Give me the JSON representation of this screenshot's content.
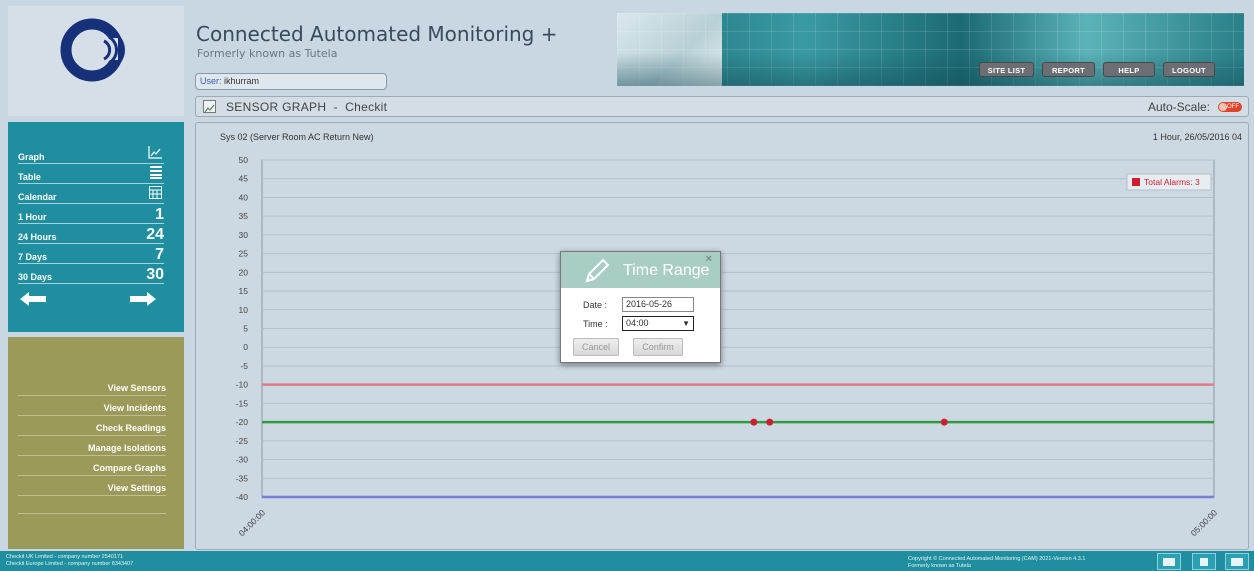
{
  "header": {
    "title": "Connected Automated Monitoring +",
    "subtitle": "Formerly known as Tutela",
    "user_label": "User:",
    "user_name": "ikhurram"
  },
  "top_nav": [
    {
      "label": "SITE LIST"
    },
    {
      "label": "REPORT"
    },
    {
      "label": "HELP"
    },
    {
      "label": "LOGOUT"
    }
  ],
  "graph_bar": {
    "title": "SENSOR GRAPH",
    "separator": "-",
    "subtitle": "Checkit",
    "autoscale_label": "Auto-Scale:",
    "autoscale_state": "OFF"
  },
  "sidebar": {
    "items": [
      {
        "label": "Graph",
        "icon": "chart-icon"
      },
      {
        "label": "Table",
        "icon": "table-icon"
      },
      {
        "label": "Calendar",
        "icon": "calendar-icon"
      },
      {
        "label": "1 Hour",
        "value": "1"
      },
      {
        "label": "24 Hours",
        "value": "24"
      },
      {
        "label": "7 Days",
        "value": "7"
      },
      {
        "label": "30 Days",
        "value": "30"
      }
    ],
    "prev_icon": "arrow-left-icon",
    "next_icon": "arrow-right-icon",
    "links": [
      {
        "label": "View Sensors"
      },
      {
        "label": "View Incidents"
      },
      {
        "label": "Check Readings"
      },
      {
        "label": "Manage Isolations"
      },
      {
        "label": "Compare Graphs"
      },
      {
        "label": "View Settings"
      }
    ]
  },
  "chart_data": {
    "type": "line",
    "title": "Sys 02 (Server Room AC Return New)",
    "range_label": "1 Hour, 26/05/2016 04",
    "y_ticks": [
      "50",
      "45",
      "40",
      "35",
      "30",
      "25",
      "20",
      "15",
      "10",
      "5",
      "0",
      "-5",
      "-10",
      "-15",
      "-20",
      "-25",
      "-30",
      "-35",
      "-40"
    ],
    "ylim": [
      -40,
      50
    ],
    "x_ticks": [
      "04:00:00",
      "05:00:00"
    ],
    "xlim": [
      "04:00:00",
      "05:00:00"
    ],
    "thresholds": [
      {
        "value": -10,
        "color": "#e07a86"
      },
      {
        "value": -40,
        "color": "#7b7fd6"
      }
    ],
    "series": [
      {
        "values": [
          -20,
          -20
        ],
        "x": [
          "04:00:00",
          "05:00:00"
        ],
        "color": "#2e9b3c"
      }
    ],
    "alarm_points": [
      {
        "x": "04:31:00",
        "y": -20
      },
      {
        "x": "04:32:00",
        "y": -20
      },
      {
        "x": "04:43:00",
        "y": -20
      }
    ],
    "legend": {
      "label": "Total Alarms: 3",
      "color": "#cc1f2f",
      "position": "top-right"
    },
    "grid": true
  },
  "modal": {
    "title": "Time Range",
    "close": "×",
    "date_label": "Date :",
    "date_value": "2016-05-26",
    "time_label": "Time :",
    "time_value": "04:00",
    "cancel_label": "Cancel",
    "confirm_label": "Confirm"
  },
  "footer": {
    "company_lines": [
      "Checkit UK Limited - company number 2540171",
      "Checkit Europe Limited - company number 8343407"
    ],
    "copyright": "Copyright © Connected Automated Monitoring (CAM) 2021-Version 4.3.1",
    "copyright_sub": "Formerly known as Tutela"
  }
}
